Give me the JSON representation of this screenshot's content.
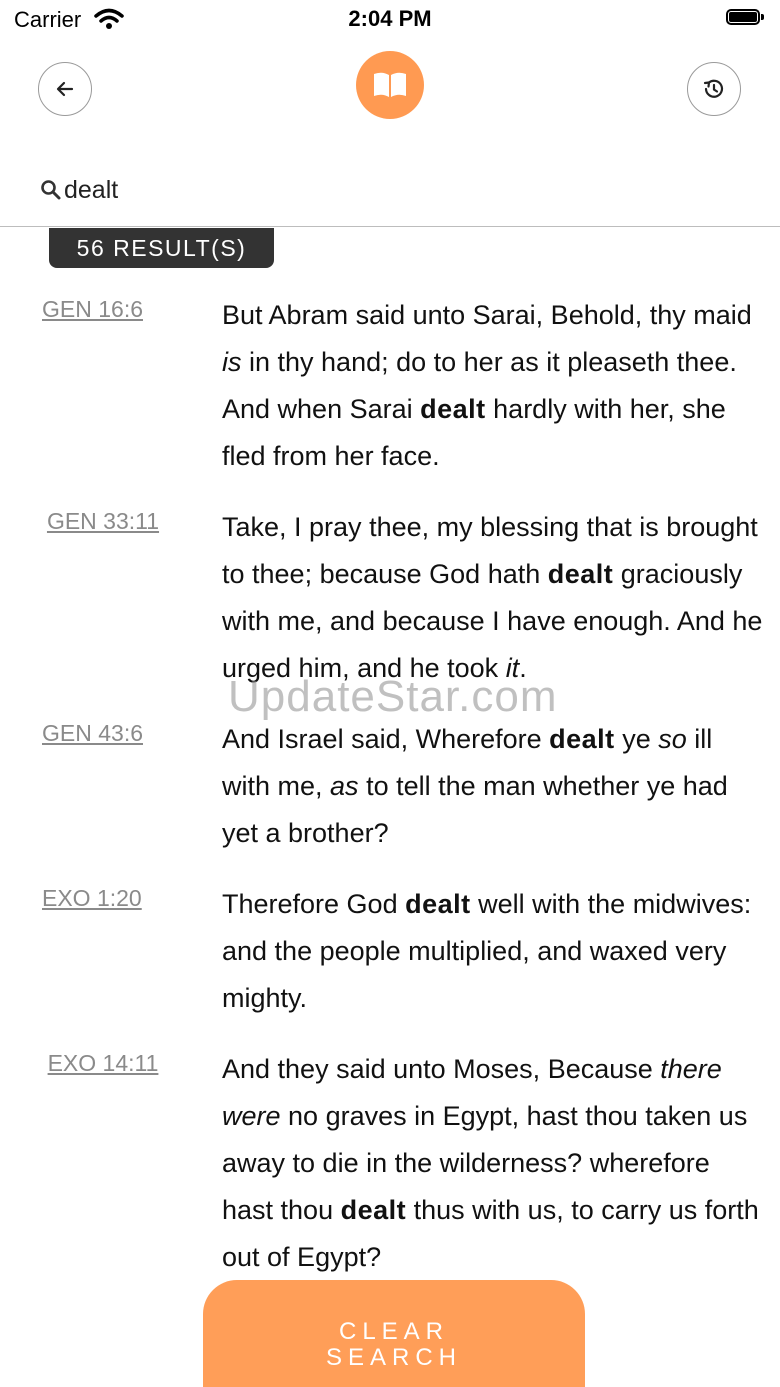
{
  "status_bar": {
    "carrier": "Carrier",
    "time": "2:04 PM"
  },
  "header": {
    "back_icon": "arrow-left-icon",
    "logo_icon": "open-book-icon",
    "history_icon": "history-clock-icon",
    "accent_color": "#ff9a52"
  },
  "search": {
    "icon": "search-icon",
    "value": "dealt",
    "results_label": "56 RESULT(S)"
  },
  "results": [
    {
      "ref": "GEN 16:6",
      "segments": [
        {
          "t": "But Abram said unto Sarai, Behold, thy maid ",
          "s": "n"
        },
        {
          "t": "is",
          "s": "i"
        },
        {
          "t": " in thy hand; do to her as it pleaseth thee. And when Sarai ",
          "s": "n"
        },
        {
          "t": "dealt",
          "s": "b"
        },
        {
          "t": " hardly with her, she fled from her face.",
          "s": "n"
        }
      ]
    },
    {
      "ref": "GEN 33:11",
      "segments": [
        {
          "t": "Take, I pray thee, my blessing that is brought to thee; because God hath ",
          "s": "n"
        },
        {
          "t": "dealt",
          "s": "b"
        },
        {
          "t": " graciously with me, and because I have enough. And he urged him, and he took ",
          "s": "n"
        },
        {
          "t": "it",
          "s": "i"
        },
        {
          "t": ".",
          "s": "n"
        }
      ]
    },
    {
      "ref": "GEN 43:6",
      "segments": [
        {
          "t": "And Israel said, Wherefore ",
          "s": "n"
        },
        {
          "t": "dealt",
          "s": "b"
        },
        {
          "t": " ye ",
          "s": "n"
        },
        {
          "t": "so",
          "s": "i"
        },
        {
          "t": " ill with me, ",
          "s": "n"
        },
        {
          "t": "as",
          "s": "i"
        },
        {
          "t": " to tell the man whether ye had yet a brother?",
          "s": "n"
        }
      ]
    },
    {
      "ref": "EXO 1:20",
      "segments": [
        {
          "t": "Therefore God ",
          "s": "n"
        },
        {
          "t": "dealt",
          "s": "b"
        },
        {
          "t": " well with the midwives: and the people multiplied, and waxed very mighty.",
          "s": "n"
        }
      ]
    },
    {
      "ref": "EXO 14:11",
      "segments": [
        {
          "t": "And they said unto Moses, Because ",
          "s": "n"
        },
        {
          "t": "there were",
          "s": "i"
        },
        {
          "t": " no graves in Egypt, hast thou taken us away to die in the wilderness? wherefore hast thou ",
          "s": "n"
        },
        {
          "t": "dealt",
          "s": "b"
        },
        {
          "t": " thus with us, to carry us forth out of Egypt?",
          "s": "n"
        }
      ]
    }
  ],
  "watermark": "UpdateStar.com",
  "clear_button": {
    "line1": "CLEAR",
    "line2": "SEARCH",
    "color": "#ff9e58"
  }
}
